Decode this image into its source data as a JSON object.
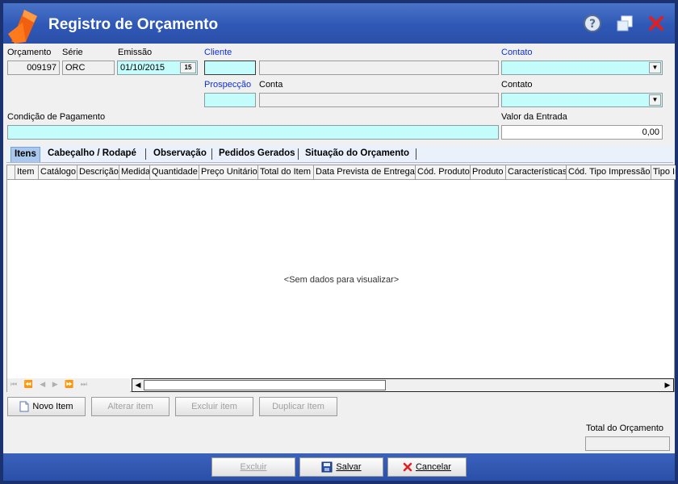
{
  "window": {
    "title": "Registro de Orçamento"
  },
  "header": {
    "orcamento_label": "Orçamento",
    "orcamento_value": "009197",
    "serie_label": "Série",
    "serie_value": "ORC",
    "emissao_label": "Emissão",
    "emissao_value": "01/10/2015",
    "calendar_glyph": "15",
    "cliente_label": "Cliente",
    "cliente_code": "",
    "cliente_name": "",
    "contato_label": "Contato",
    "contato_value": "",
    "prospeccao_label": "Prospecção",
    "prospeccao_value": "",
    "conta_label": "Conta",
    "conta_value": "",
    "contato2_label": "Contato",
    "contato2_value": "",
    "condicao_label": "Condição de Pagamento",
    "condicao_value": "",
    "valor_entrada_label": "Valor da Entrada",
    "valor_entrada_value": "0,00"
  },
  "tabs": [
    "Itens",
    "Cabeçalho / Rodapé",
    "Observação",
    "Pedidos Gerados",
    "Situação do Orçamento"
  ],
  "grid": {
    "columns": [
      "Item",
      "Catálogo",
      "Descrição",
      "Medida",
      "Quantidade",
      "Preço Unitário",
      "Total do Item",
      "Data Prevista de Entrega",
      "Cód. Produto",
      "Produto",
      "Características",
      "Cód. Tipo Impressão",
      "Tipo Im"
    ],
    "empty_text": "<Sem dados para visualizar>",
    "nav_glyphs": "⏮ ⏪ ◀ ▶ ⏩ ⏭"
  },
  "item_buttons": {
    "novo": "Novo Item",
    "alterar": "Alterar item",
    "excluir": "Excluir item",
    "duplicar": "Duplicar Item"
  },
  "total": {
    "label": "Total do Orçamento",
    "value": ""
  },
  "footer": {
    "excluir": "Excluir",
    "salvar": "Salvar",
    "cancelar": "Cancelar"
  },
  "icons": {
    "app": "app-logo-icon",
    "help": "help-icon",
    "restore": "restore-icon",
    "close": "close-icon"
  },
  "colors": {
    "titlebar": "#2f58b6",
    "field_highlight": "#c4fbfb",
    "link_label": "#1030d0",
    "close": "#e02020"
  }
}
